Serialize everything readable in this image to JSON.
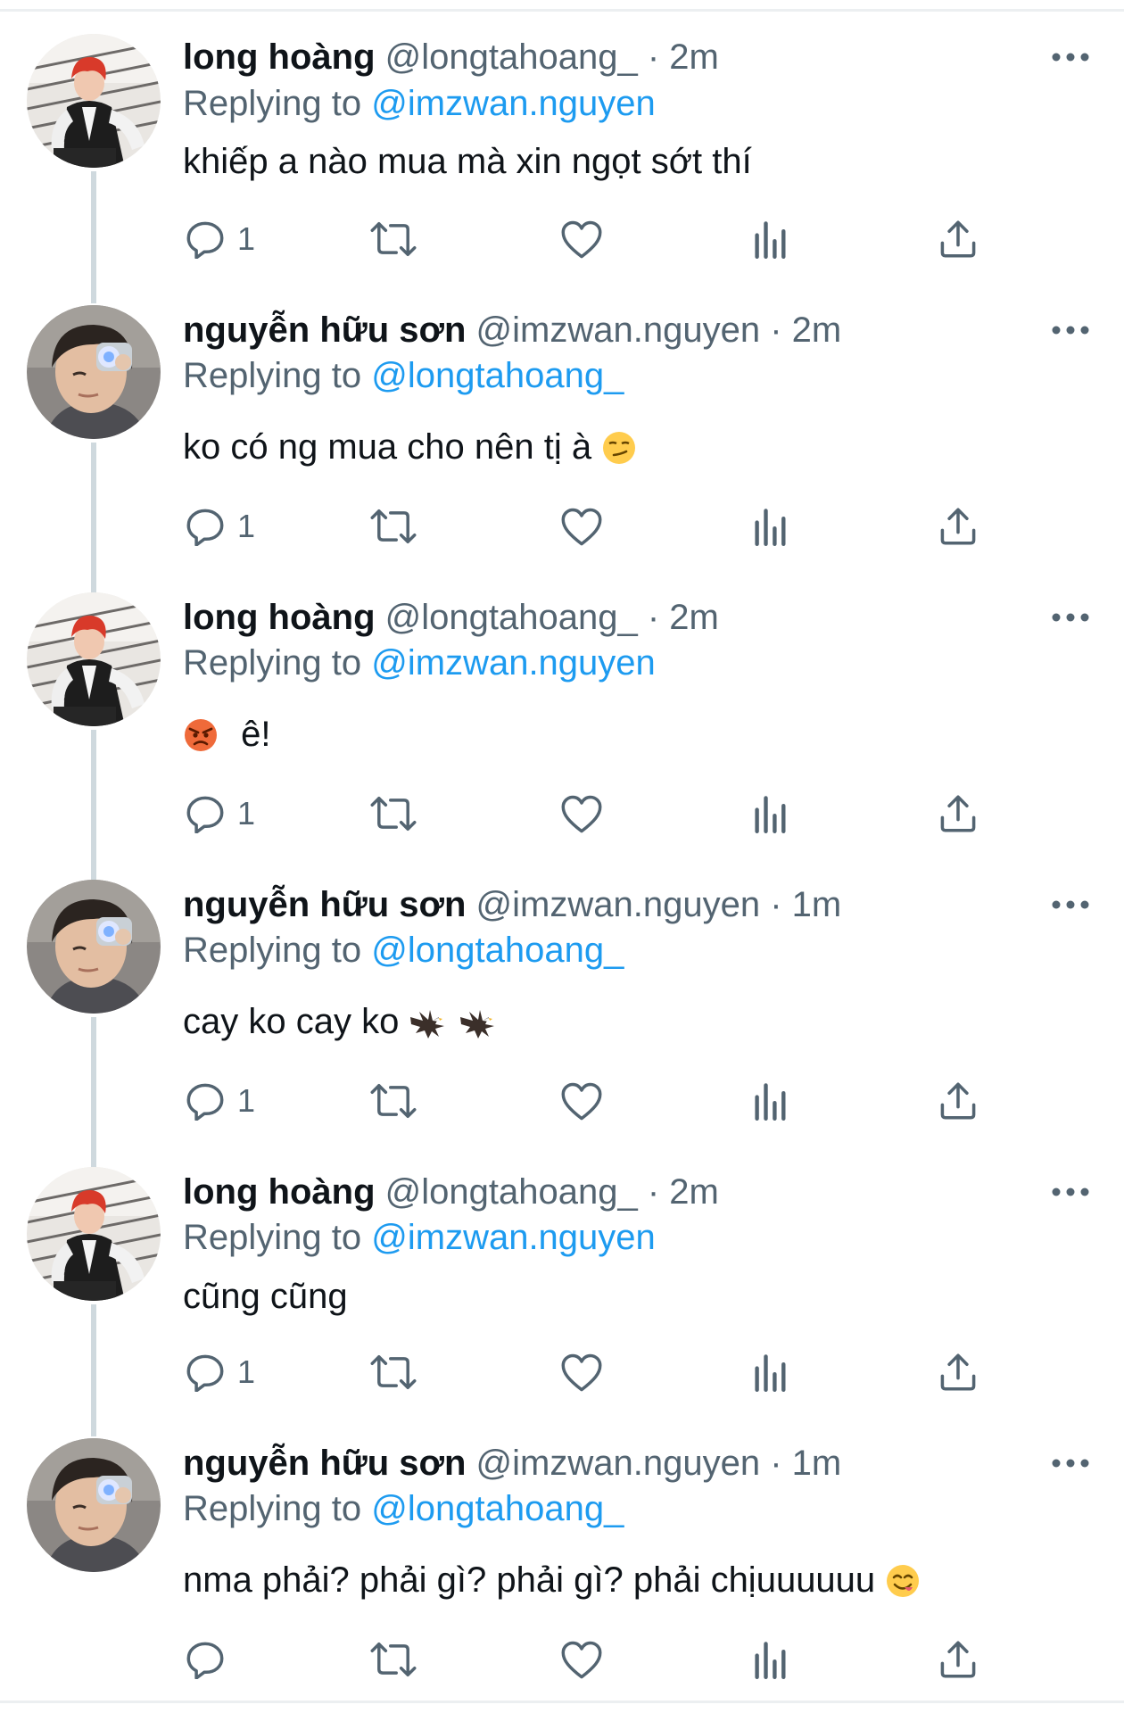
{
  "theme": {
    "accent": "#1d9bf0",
    "text": "#0f1419",
    "secondary": "#536471",
    "thread_line": "#cfd9de"
  },
  "tweets": [
    {
      "author": "long hoàng",
      "handle": "@longtahoang_",
      "dot": "·",
      "time": "2m",
      "replying_label": "Replying to",
      "replying_to": "@imzwan.nguyen",
      "text": "khiếp a nào mua mà xin ngọt sớt thí",
      "emojis": [],
      "reply_count": "1",
      "avatar_icon": "avatar-red-hair"
    },
    {
      "author": "nguyễn hữu sơn",
      "handle": "@imzwan.nguyen",
      "dot": "·",
      "time": "2m",
      "replying_label": "Replying to",
      "replying_to": "@longtahoang_",
      "text": "ko có ng mua cho nên tị à",
      "emojis": [
        "smirk"
      ],
      "reply_count": "1",
      "avatar_icon": "avatar-camera-selfie"
    },
    {
      "author": "long hoàng",
      "handle": "@longtahoang_",
      "dot": "·",
      "time": "2m",
      "replying_label": "Replying to",
      "replying_to": "@imzwan.nguyen",
      "text": "ê!",
      "emojis": [
        "angry"
      ],
      "reply_count": "1",
      "avatar_icon": "avatar-red-hair"
    },
    {
      "author": "nguyễn hữu sơn",
      "handle": "@imzwan.nguyen",
      "dot": "·",
      "time": "1m",
      "replying_label": "Replying to",
      "replying_to": "@longtahoang_",
      "text": "cay ko cay ko",
      "emojis": [
        "eagle",
        "eagle"
      ],
      "reply_count": "1",
      "avatar_icon": "avatar-camera-selfie"
    },
    {
      "author": "long hoàng",
      "handle": "@longtahoang_",
      "dot": "·",
      "time": "2m",
      "replying_label": "Replying to",
      "replying_to": "@imzwan.nguyen",
      "text": "cũng cũng",
      "emojis": [],
      "reply_count": "1",
      "avatar_icon": "avatar-red-hair"
    },
    {
      "author": "nguyễn hữu sơn",
      "handle": "@imzwan.nguyen",
      "dot": "·",
      "time": "1m",
      "replying_label": "Replying to",
      "replying_to": "@longtahoang_",
      "text": "nma phải? phải gì? phải gì? phải chịuuuuuu",
      "emojis": [
        "yum"
      ],
      "reply_count": "",
      "avatar_icon": "avatar-camera-selfie"
    }
  ]
}
